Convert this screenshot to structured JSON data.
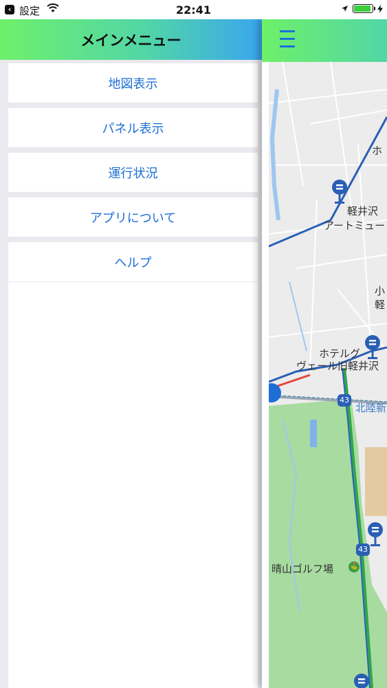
{
  "status_bar": {
    "back_app": "設定",
    "time": "22:41",
    "battery_level": 0.85
  },
  "side_menu": {
    "title": "メインメニュー",
    "items": [
      {
        "label": "地図表示"
      },
      {
        "label": "パネル表示"
      },
      {
        "label": "運行状況"
      },
      {
        "label": "アプリについて"
      },
      {
        "label": "ヘルプ"
      }
    ]
  },
  "map": {
    "labels": {
      "hotel_top": "ホ",
      "karuizawa_art": "軽井沢",
      "art_museum": "アートミュー",
      "ko": "小",
      "kei": "軽",
      "hotel": "ホテルグ",
      "verl": "ヴェール旧軽井沢",
      "hokuriku": "北陸新",
      "golf": "晴山ゴルフ場"
    },
    "route_badges": [
      "43",
      "43"
    ]
  },
  "colors": {
    "accent": "#1d6fd6",
    "route_line": "#2a5fb5",
    "header_green": "#6ef06a",
    "header_blue": "#3aa6ee",
    "map_green": "#a8dba0",
    "water": "#9ec7f0"
  }
}
